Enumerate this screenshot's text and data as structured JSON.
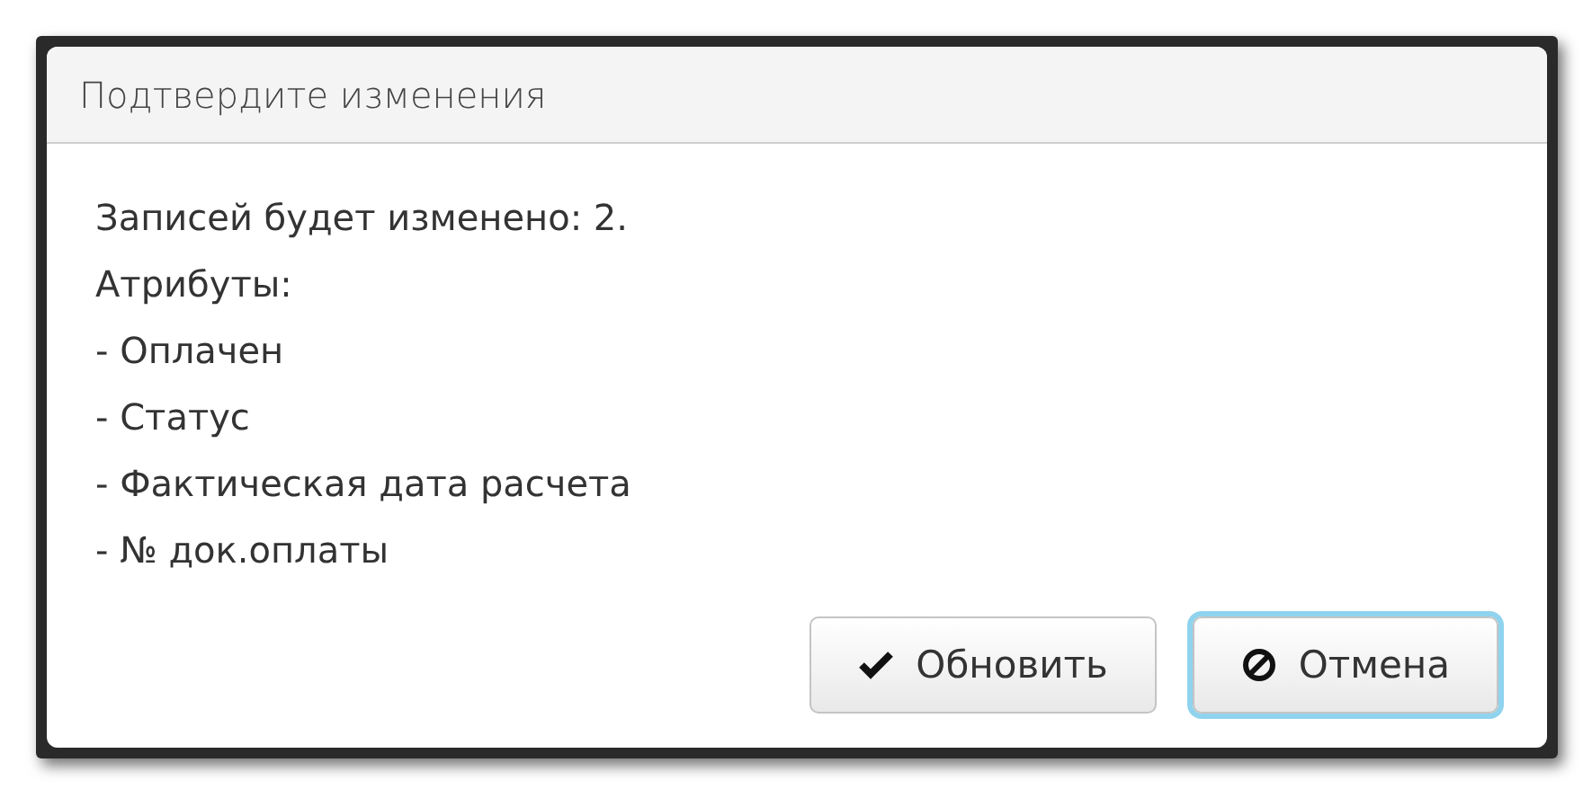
{
  "dialog": {
    "title": "Подтвердите изменения",
    "lines": [
      "Записей будет изменено: 2.",
      "Атрибуты:",
      "- Оплачен",
      "- Статус",
      "- Фактическая дата расчета",
      "- № док.оплаты"
    ],
    "buttons": [
      {
        "label": "Обновить",
        "kind": "confirm",
        "focused": false
      },
      {
        "label": "Отмена",
        "kind": "cancel",
        "focused": true
      }
    ]
  }
}
